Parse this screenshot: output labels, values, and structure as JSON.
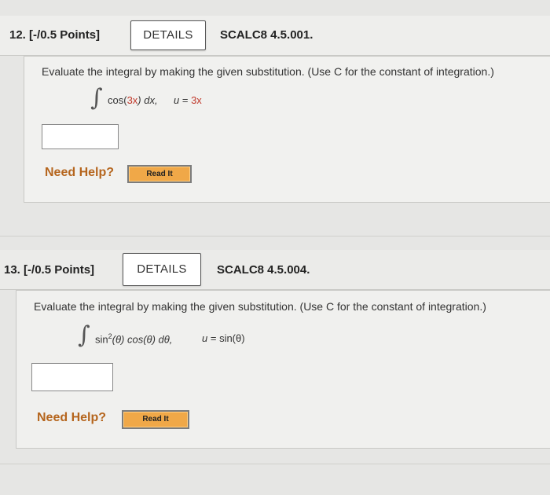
{
  "questions": [
    {
      "number": "12.",
      "points": "[-/0.5 Points]",
      "details_label": "DETAILS",
      "code": "SCALC8 4.5.001.",
      "prompt": "Evaluate the integral by making the given substitution. (Use C for the constant of integration.)",
      "integral_symbol": "∫",
      "integrand_pre": "cos(",
      "integrand_inner": "3x",
      "integrand_post": ") dx,",
      "sub_var": "u",
      "sub_eq": " = ",
      "sub_value": "3x",
      "answer_value": "",
      "need_help": "Need Help?",
      "read_it": "Read It"
    },
    {
      "number": "13.",
      "points": "[-/0.5 Points]",
      "details_label": "DETAILS",
      "code": "SCALC8 4.5.004.",
      "prompt": "Evaluate the integral by making the given substitution. (Use C for the constant of integration.)",
      "integral_symbol": "∫",
      "integrand_a": "sin",
      "integrand_sup": "2",
      "integrand_b": "(θ) cos(θ) dθ,",
      "sub_var": "u",
      "sub_eq": " = ",
      "sub_value": "sin(θ)",
      "answer_value": "",
      "need_help": "Need Help?",
      "read_it": "Read It"
    }
  ],
  "colors": {
    "need_help": "#b5651d",
    "read_it_bg": "#f0a848",
    "substitution_red": "#c0392b"
  }
}
